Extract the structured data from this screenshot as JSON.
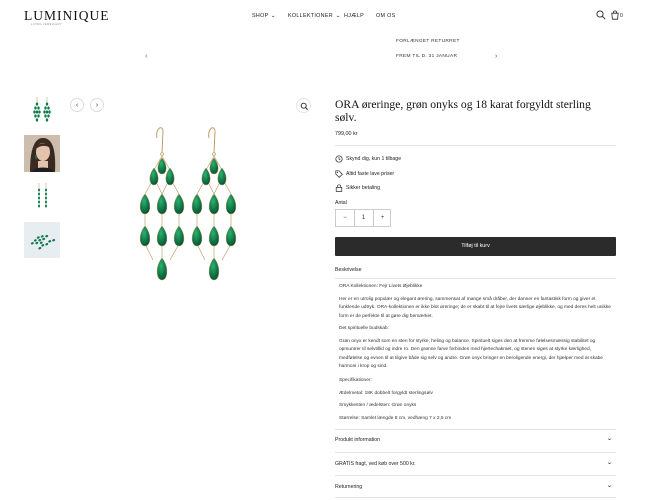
{
  "header": {
    "logo": "LUMINIQUE",
    "logo_sub": "LIVING JEWELLERY",
    "nav": [
      {
        "label": "SHOP",
        "dropdown": true
      },
      {
        "label": "KOLLEKTIONER",
        "dropdown": true
      },
      {
        "label": "HJÆLP",
        "dropdown": false
      },
      {
        "label": "OM OS",
        "dropdown": false
      }
    ],
    "cart_count": "0",
    "icons": [
      "search-icon",
      "cart-bag-icon"
    ]
  },
  "announcement": {
    "line1": "FORLÆNGET RETURRET",
    "line2": "FREM TIL D. 31 JANUAR"
  },
  "gallery": {
    "thumbnails": [
      "earring-pair-thumbnail",
      "model-wearing-thumbnail",
      "earring-side-thumbnail",
      "earring-lying-thumbnail"
    ],
    "main_image": "green-onyx-chandelier-earrings",
    "stone_color": "#0f7a4a",
    "metal_color": "#b8925a"
  },
  "product": {
    "title": "ORA øreringe, grøn onyks og 18 karat forgyldt sterling sølv.",
    "price": "799,00 kr",
    "features": [
      {
        "icon": "clock-icon",
        "text": "Skynd dig, kun 1 tilbage"
      },
      {
        "icon": "tag-icon",
        "text": "Altid faste lave priser"
      },
      {
        "icon": "lock-icon",
        "text": "Sikker betaling"
      }
    ],
    "quantity_label": "Antal",
    "quantity": "1",
    "minus": "−",
    "plus": "+",
    "add_to_cart": "Tilføj til kurv"
  },
  "accordion": {
    "description_title": "Beskrivelse",
    "description": [
      "ORA Kollektionen: Fejr Livets Øjeblikke",
      "Her er en utrolig populær og elegant ørering, sammensat af mange små dråber, der danner en fantastisk form og giver et funklende udtryk. ORA-kollektionen er ikke blot øreringe; de er skabt til at fejre livets særlige øjeblikke, og med deres helt unikke form er de perfekte til at gøre dig bemærket.",
      "Det spirituelle budskab:",
      "Grøn onyx er kendt som en sten for styrke, heling og balance. Spirituelt siges den at fremme følelsesmæssig stabilitet og opmuntrer til selvtillid og indre ro. Den grønne farve forbindes med hjertechakraet, og stenen siges at styrke kærlighed, medfølelse og evnen til at tilgive både sig selv og andre. Grøn onyx bringer en beroligende energi, der hjælper med at skabe harmoni i krop og sind.",
      "Specifikationer:",
      "Ædelmetal: 18K dobbelt forgyldt sterlingsølv",
      "Smykkesten / ædelsten: Grøn onyks",
      "Størrelse: Samlet længde 8 cm, vedhæng 7 x 2,5 cm"
    ],
    "sections": [
      "Produkt information",
      "GRATIS fragt, ved køb over 500 kr.",
      "Returnering"
    ]
  }
}
